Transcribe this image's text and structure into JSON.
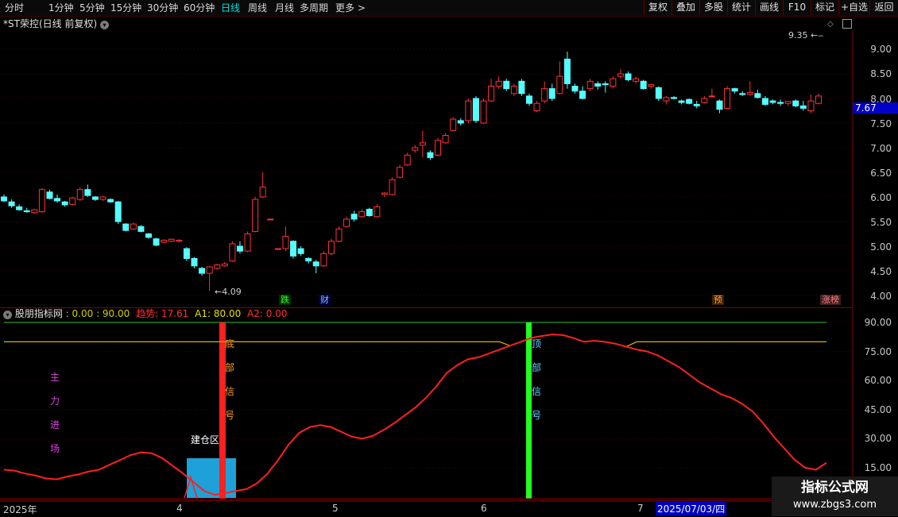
{
  "toolbar": {
    "periods": [
      "分时",
      "1分钟",
      "5分钟",
      "15分钟",
      "30分钟",
      "60分钟",
      "日线",
      "周线",
      "月线",
      "多周期",
      "更多 >"
    ],
    "active_period": "日线",
    "right_buttons": [
      "复权",
      "叠加",
      "多股",
      "统计",
      "画线",
      "F10",
      "标记",
      "+自选",
      "返回"
    ]
  },
  "title": "*ST荣控(日线 前复权)",
  "price_axis": [
    "9.00",
    "8.50",
    "8.00",
    "7.50",
    "7.00",
    "6.50",
    "6.00",
    "5.50",
    "5.00",
    "4.50",
    "4.00"
  ],
  "current_price": "7.67",
  "high_label": "9.35",
  "low_label": "4.09",
  "markers": {
    "die": "跌",
    "cai": "财",
    "yu": "预",
    "zhangting": "涨榜"
  },
  "indicator": {
    "name": "股朋指标网",
    "v1": ": 0.00 : 90.00",
    "trend_label": "趋势: 17.61",
    "a1_label": "A1: 80.00",
    "a2_label": "A2: 0.00",
    "axis": [
      "90.00",
      "75.00",
      "60.00",
      "45.00",
      "30.00",
      "15.00"
    ],
    "main_force": [
      "主",
      "力",
      "进",
      "场"
    ],
    "bottom_signal": [
      "底",
      "部",
      "信",
      "号"
    ],
    "top_signal": [
      "顶",
      "部",
      "信",
      "号"
    ],
    "build_zone": "建仓区"
  },
  "dates": {
    "year": "2025年",
    "m4": "4",
    "m5": "5",
    "m6": "6",
    "m7": "7",
    "cursor": "2025/07/03/四"
  },
  "watermark": {
    "line1": "指标公式网",
    "line2": "www.zbgs3.com"
  },
  "colors": {
    "up": "#ff3232",
    "down": "#54ffff",
    "grid": "#500000",
    "axis_line": "#800000"
  },
  "chart_data": {
    "type": "candlestick",
    "candles": [
      [
        6.0,
        6.05,
        5.9,
        5.92
      ],
      [
        5.9,
        5.95,
        5.78,
        5.82
      ],
      [
        5.8,
        5.85,
        5.72,
        5.74
      ],
      [
        5.72,
        5.78,
        5.68,
        5.7
      ],
      [
        5.68,
        5.76,
        5.66,
        5.74
      ],
      [
        5.7,
        6.18,
        5.68,
        6.15
      ],
      [
        6.1,
        6.15,
        5.95,
        5.97
      ],
      [
        5.97,
        6.05,
        5.88,
        5.92
      ],
      [
        5.9,
        5.92,
        5.8,
        5.84
      ],
      [
        5.85,
        6.0,
        5.83,
        5.98
      ],
      [
        5.95,
        6.2,
        5.92,
        6.15
      ],
      [
        6.15,
        6.25,
        6.0,
        6.03
      ],
      [
        6.0,
        6.02,
        5.92,
        5.95
      ],
      [
        5.95,
        6.02,
        5.92,
        6.0
      ],
      [
        5.95,
        5.97,
        5.88,
        5.9
      ],
      [
        5.9,
        5.92,
        5.45,
        5.5
      ],
      [
        5.45,
        5.47,
        5.3,
        5.32
      ],
      [
        5.35,
        5.48,
        5.33,
        5.45
      ],
      [
        5.4,
        5.43,
        5.28,
        5.3
      ],
      [
        5.25,
        5.27,
        5.15,
        5.18
      ],
      [
        5.15,
        5.17,
        5.0,
        5.02
      ],
      [
        5.08,
        5.14,
        5.06,
        5.12
      ],
      [
        5.1,
        5.16,
        5.08,
        5.14
      ],
      [
        5.1,
        5.14,
        5.08,
        5.12
      ],
      [
        4.95,
        4.98,
        4.7,
        4.75
      ],
      [
        4.75,
        4.78,
        4.55,
        4.6
      ],
      [
        4.55,
        4.58,
        4.4,
        4.45
      ],
      [
        4.45,
        4.6,
        4.09,
        4.58
      ],
      [
        4.55,
        4.64,
        4.52,
        4.62
      ],
      [
        4.6,
        4.68,
        4.58,
        4.64
      ],
      [
        4.7,
        5.1,
        4.68,
        5.05
      ],
      [
        5.0,
        5.1,
        4.85,
        4.9
      ],
      [
        4.9,
        5.3,
        4.88,
        5.25
      ],
      [
        5.3,
        6.0,
        5.28,
        5.95
      ],
      [
        6.0,
        6.5,
        5.98,
        6.2
      ],
      [
        5.55,
        5.55,
        5.55,
        5.55
      ],
      [
        4.95,
        4.95,
        4.95,
        4.95
      ],
      [
        4.95,
        5.4,
        4.9,
        5.2
      ],
      [
        5.1,
        5.12,
        4.75,
        4.8
      ],
      [
        4.95,
        5.0,
        4.8,
        4.85
      ],
      [
        4.75,
        4.78,
        4.65,
        4.7
      ],
      [
        4.68,
        4.72,
        4.45,
        4.6
      ],
      [
        4.6,
        4.9,
        4.58,
        4.85
      ],
      [
        4.85,
        5.15,
        4.82,
        5.1
      ],
      [
        5.1,
        5.4,
        5.08,
        5.35
      ],
      [
        5.4,
        5.6,
        5.38,
        5.55
      ],
      [
        5.65,
        5.72,
        5.5,
        5.55
      ],
      [
        5.6,
        5.75,
        5.58,
        5.7
      ],
      [
        5.75,
        5.78,
        5.6,
        5.62
      ],
      [
        5.6,
        5.85,
        5.58,
        5.8
      ],
      [
        6.05,
        6.1,
        6.0,
        6.08
      ],
      [
        6.05,
        6.4,
        6.03,
        6.35
      ],
      [
        6.4,
        6.65,
        6.38,
        6.6
      ],
      [
        6.65,
        6.9,
        6.63,
        6.85
      ],
      [
        6.95,
        7.05,
        6.9,
        7.0
      ],
      [
        7.05,
        7.35,
        6.8,
        7.1
      ],
      [
        6.9,
        6.95,
        6.75,
        6.8
      ],
      [
        6.85,
        7.2,
        6.83,
        7.15
      ],
      [
        7.1,
        7.3,
        7.08,
        7.25
      ],
      [
        7.35,
        7.62,
        7.33,
        7.58
      ],
      [
        7.55,
        7.6,
        7.45,
        7.5
      ],
      [
        7.55,
        8.0,
        7.5,
        7.95
      ],
      [
        8.0,
        8.05,
        7.5,
        7.55
      ],
      [
        7.5,
        8.0,
        7.48,
        7.95
      ],
      [
        7.95,
        8.4,
        7.93,
        8.25
      ],
      [
        8.25,
        8.45,
        8.2,
        8.35
      ],
      [
        8.35,
        8.4,
        8.15,
        8.2
      ],
      [
        8.1,
        8.3,
        8.05,
        8.25
      ],
      [
        8.35,
        8.4,
        8.05,
        8.1
      ],
      [
        8.05,
        8.1,
        7.85,
        7.9
      ],
      [
        7.75,
        7.95,
        7.72,
        7.9
      ],
      [
        7.95,
        8.35,
        7.9,
        8.2
      ],
      [
        8.2,
        8.3,
        7.95,
        8.0
      ],
      [
        8.1,
        8.75,
        8.08,
        8.45
      ],
      [
        8.8,
        8.95,
        8.2,
        8.3
      ],
      [
        8.25,
        8.3,
        8.1,
        8.15
      ],
      [
        8.15,
        8.25,
        7.98,
        8.0
      ],
      [
        8.2,
        8.4,
        8.15,
        8.35
      ],
      [
        8.3,
        8.35,
        8.18,
        8.25
      ],
      [
        8.3,
        8.35,
        8.12,
        8.28
      ],
      [
        8.25,
        8.45,
        8.2,
        8.4
      ],
      [
        8.45,
        8.6,
        8.4,
        8.5
      ],
      [
        8.5,
        8.55,
        8.35,
        8.38
      ],
      [
        8.35,
        8.45,
        8.3,
        8.4
      ],
      [
        8.35,
        8.38,
        8.18,
        8.2
      ],
      [
        8.25,
        8.3,
        8.2,
        8.28
      ],
      [
        8.22,
        8.25,
        7.95,
        8.0
      ],
      [
        7.95,
        8.05,
        7.88,
        8.02
      ],
      [
        8.02,
        8.05,
        7.98,
        8.0
      ],
      [
        7.95,
        7.98,
        7.88,
        7.92
      ],
      [
        7.98,
        8.0,
        7.88,
        7.9
      ],
      [
        7.88,
        7.95,
        7.8,
        7.85
      ],
      [
        7.92,
        8.05,
        7.9,
        8.0
      ],
      [
        8.05,
        8.2,
        8.03,
        8.05
      ],
      [
        7.95,
        7.98,
        7.7,
        7.78
      ],
      [
        7.8,
        8.25,
        7.78,
        8.2
      ],
      [
        8.2,
        8.22,
        8.1,
        8.15
      ],
      [
        8.1,
        8.15,
        8.05,
        8.08
      ],
      [
        8.08,
        8.35,
        8.06,
        8.12
      ],
      [
        8.1,
        8.18,
        8.0,
        8.02
      ],
      [
        8.0,
        8.05,
        7.85,
        7.88
      ],
      [
        7.95,
        7.98,
        7.88,
        7.92
      ],
      [
        7.92,
        7.98,
        7.85,
        7.9
      ],
      [
        7.9,
        7.95,
        7.85,
        7.94
      ],
      [
        7.95,
        7.98,
        7.82,
        7.85
      ],
      [
        7.85,
        7.95,
        7.75,
        7.8
      ],
      [
        7.75,
        8.08,
        7.7,
        7.95
      ],
      [
        7.9,
        8.1,
        7.88,
        8.05
      ]
    ],
    "trend_line": [
      14,
      13.5,
      12,
      11,
      9.5,
      9,
      10.5,
      11.5,
      13,
      14,
      16.5,
      19,
      21.5,
      23,
      22.5,
      20,
      16,
      12,
      7.5,
      3,
      1,
      2,
      3,
      4,
      7,
      12,
      19,
      27,
      33,
      36,
      37,
      36,
      33.5,
      31,
      30,
      31.5,
      34.5,
      38,
      42,
      46,
      51,
      57,
      64,
      68,
      71,
      72,
      74,
      76,
      78,
      80,
      82,
      83,
      83.8,
      83.5,
      82,
      80,
      80.5,
      80,
      79,
      77.5,
      76,
      75,
      73,
      70,
      67,
      63,
      59,
      56,
      53,
      51,
      48,
      44,
      38,
      31,
      25,
      19,
      15,
      14,
      17.6
    ],
    "a1_line": 80,
    "upper_line": 90,
    "y_range": [
      0,
      95
    ]
  }
}
